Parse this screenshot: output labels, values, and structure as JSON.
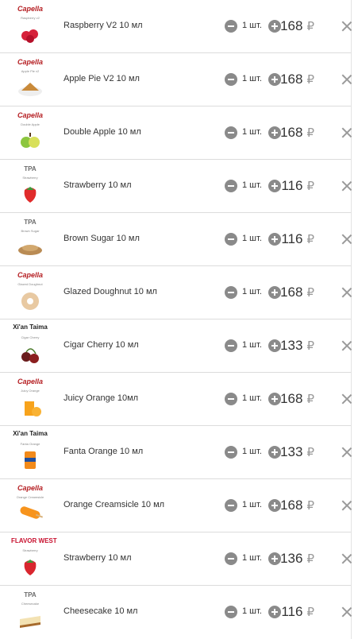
{
  "cart": {
    "items": [
      {
        "brand": "Capella",
        "brand_style": "capella",
        "sublabel": "Raspberry v2",
        "name": "Raspberry V2 10 мл",
        "qty": "1 шт.",
        "price": "168",
        "currency": "₽",
        "icon": "raspberry-icon",
        "color": "#d6213a"
      },
      {
        "brand": "Capella",
        "brand_style": "capella",
        "sublabel": "Apple Pie v2",
        "name": "Apple Pie V2 10 мл",
        "qty": "1 шт.",
        "price": "168",
        "currency": "₽",
        "icon": "apple-pie-icon",
        "color": "#c98a3a"
      },
      {
        "brand": "Capella",
        "brand_style": "capella",
        "sublabel": "Double Apple",
        "name": "Double Apple 10 мл",
        "qty": "1 шт.",
        "price": "168",
        "currency": "₽",
        "icon": "apple-icon",
        "color": "#8cc63f"
      },
      {
        "brand": "TPA",
        "brand_style": "tpa",
        "sublabel": "Strawberry",
        "name": "Strawberry 10 мл",
        "qty": "1 шт.",
        "price": "116",
        "currency": "₽",
        "icon": "strawberry-icon",
        "color": "#e02b2b"
      },
      {
        "brand": "TPA",
        "brand_style": "tpa",
        "sublabel": "Brown Sugar",
        "name": "Brown Sugar 10 мл",
        "qty": "1 шт.",
        "price": "116",
        "currency": "₽",
        "icon": "sugar-icon",
        "color": "#b98b54"
      },
      {
        "brand": "Capella",
        "brand_style": "capella",
        "sublabel": "Glazed Doughnut",
        "name": "Glazed Doughnut 10 мл",
        "qty": "1 шт.",
        "price": "168",
        "currency": "₽",
        "icon": "doughnut-icon",
        "color": "#e8c9a2"
      },
      {
        "brand": "Xi'an Taima",
        "brand_style": "xian",
        "sublabel": "Cigar Cherry",
        "name": "Cigar Cherry 10 мл",
        "qty": "1 шт.",
        "price": "133",
        "currency": "₽",
        "icon": "cherry-icon",
        "color": "#6a1d1d"
      },
      {
        "brand": "Capella",
        "brand_style": "capella",
        "sublabel": "Juicy Orange",
        "name": "Juicy Orange 10мл",
        "qty": "1 шт.",
        "price": "168",
        "currency": "₽",
        "icon": "orange-juice-icon",
        "color": "#f7a31c"
      },
      {
        "brand": "Xi'an Taima",
        "brand_style": "xian",
        "sublabel": "Fanta Orange",
        "name": "Fanta Orange 10 мл",
        "qty": "1 шт.",
        "price": "133",
        "currency": "₽",
        "icon": "orange-can-icon",
        "color": "#f28a1a"
      },
      {
        "brand": "Capella",
        "brand_style": "capella",
        "sublabel": "Orange Creamsicle",
        "name": "Orange Creamsicle 10 мл",
        "qty": "1 шт.",
        "price": "168",
        "currency": "₽",
        "icon": "creamsicle-icon",
        "color": "#f7941d"
      },
      {
        "brand": "FLAVOR WEST",
        "brand_style": "fw",
        "sublabel": "Strawberry",
        "name": "Strawberry  10 мл",
        "qty": "1 шт.",
        "price": "136",
        "currency": "₽",
        "icon": "strawberry-icon",
        "color": "#d9262e"
      },
      {
        "brand": "TPA",
        "brand_style": "tpa",
        "sublabel": "Cheesecake",
        "name": "Cheesecake 10 мл",
        "qty": "1 шт.",
        "price": "116",
        "currency": "₽",
        "icon": "cheesecake-icon",
        "color": "#f3e2b3"
      }
    ]
  }
}
